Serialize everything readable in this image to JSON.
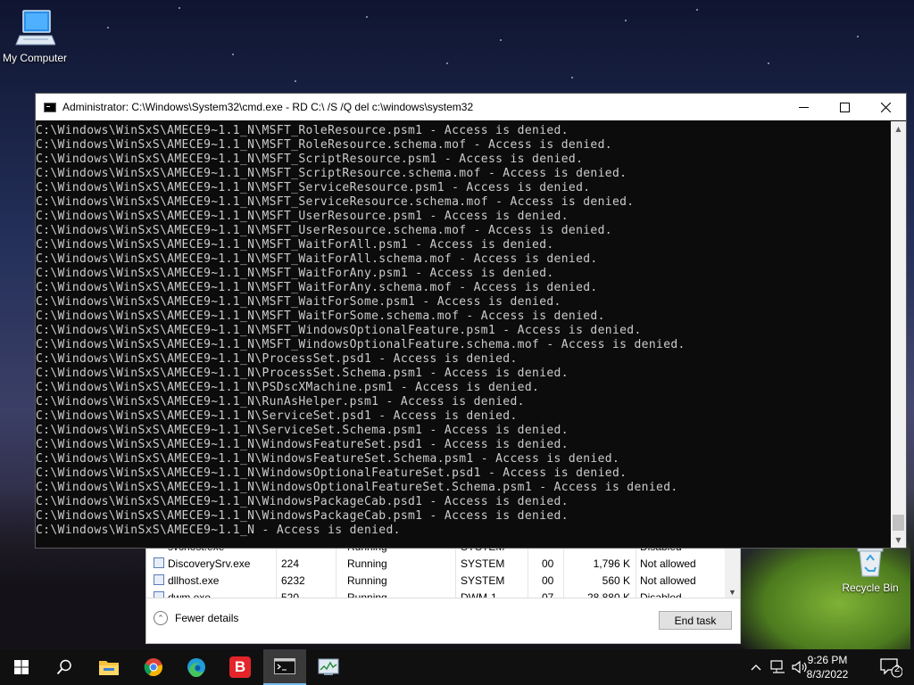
{
  "desktop": {
    "icons": [
      {
        "label": "My Computer",
        "icon": "computer-icon"
      },
      {
        "label": "Recycle Bin",
        "icon": "recycle-bin-icon"
      }
    ]
  },
  "task_manager": {
    "partial_row": {
      "name": "svchost.exe",
      "pid": "",
      "status": "Running",
      "user": "SYSTEM",
      "cpu": "",
      "memory": "",
      "uac": "Disabled"
    },
    "rows": [
      {
        "name": "DiscoverySrv.exe",
        "pid": "224",
        "status": "Running",
        "user": "SYSTEM",
        "cpu": "00",
        "memory": "1,796 K",
        "uac": "Not allowed"
      },
      {
        "name": "dllhost.exe",
        "pid": "6232",
        "status": "Running",
        "user": "SYSTEM",
        "cpu": "00",
        "memory": "560 K",
        "uac": "Not allowed"
      },
      {
        "name": "dwm.exe",
        "pid": "520",
        "status": "Running",
        "user": "DWM-1",
        "cpu": "07",
        "memory": "28,880 K",
        "uac": "Disabled"
      }
    ],
    "fewer_details_label": "Fewer details",
    "end_task_label": "End task"
  },
  "cmd": {
    "title": "Administrator: C:\\Windows\\System32\\cmd.exe - RD  C:\\ /S /Q del c:\\windows\\system32",
    "lines": [
      "C:\\Windows\\WinSxS\\AMECE9~1.1_N\\MSFT_RoleResource.psm1 - Access is denied.",
      "C:\\Windows\\WinSxS\\AMECE9~1.1_N\\MSFT_RoleResource.schema.mof - Access is denied.",
      "C:\\Windows\\WinSxS\\AMECE9~1.1_N\\MSFT_ScriptResource.psm1 - Access is denied.",
      "C:\\Windows\\WinSxS\\AMECE9~1.1_N\\MSFT_ScriptResource.schema.mof - Access is denied.",
      "C:\\Windows\\WinSxS\\AMECE9~1.1_N\\MSFT_ServiceResource.psm1 - Access is denied.",
      "C:\\Windows\\WinSxS\\AMECE9~1.1_N\\MSFT_ServiceResource.schema.mof - Access is denied.",
      "C:\\Windows\\WinSxS\\AMECE9~1.1_N\\MSFT_UserResource.psm1 - Access is denied.",
      "C:\\Windows\\WinSxS\\AMECE9~1.1_N\\MSFT_UserResource.schema.mof - Access is denied.",
      "C:\\Windows\\WinSxS\\AMECE9~1.1_N\\MSFT_WaitForAll.psm1 - Access is denied.",
      "C:\\Windows\\WinSxS\\AMECE9~1.1_N\\MSFT_WaitForAll.schema.mof - Access is denied.",
      "C:\\Windows\\WinSxS\\AMECE9~1.1_N\\MSFT_WaitForAny.psm1 - Access is denied.",
      "C:\\Windows\\WinSxS\\AMECE9~1.1_N\\MSFT_WaitForAny.schema.mof - Access is denied.",
      "C:\\Windows\\WinSxS\\AMECE9~1.1_N\\MSFT_WaitForSome.psm1 - Access is denied.",
      "C:\\Windows\\WinSxS\\AMECE9~1.1_N\\MSFT_WaitForSome.schema.mof - Access is denied.",
      "C:\\Windows\\WinSxS\\AMECE9~1.1_N\\MSFT_WindowsOptionalFeature.psm1 - Access is denied.",
      "C:\\Windows\\WinSxS\\AMECE9~1.1_N\\MSFT_WindowsOptionalFeature.schema.mof - Access is denied.",
      "C:\\Windows\\WinSxS\\AMECE9~1.1_N\\ProcessSet.psd1 - Access is denied.",
      "C:\\Windows\\WinSxS\\AMECE9~1.1_N\\ProcessSet.Schema.psm1 - Access is denied.",
      "C:\\Windows\\WinSxS\\AMECE9~1.1_N\\PSDscXMachine.psm1 - Access is denied.",
      "C:\\Windows\\WinSxS\\AMECE9~1.1_N\\RunAsHelper.psm1 - Access is denied.",
      "C:\\Windows\\WinSxS\\AMECE9~1.1_N\\ServiceSet.psd1 - Access is denied.",
      "C:\\Windows\\WinSxS\\AMECE9~1.1_N\\ServiceSet.Schema.psm1 - Access is denied.",
      "C:\\Windows\\WinSxS\\AMECE9~1.1_N\\WindowsFeatureSet.psd1 - Access is denied.",
      "C:\\Windows\\WinSxS\\AMECE9~1.1_N\\WindowsFeatureSet.Schema.psm1 - Access is denied.",
      "C:\\Windows\\WinSxS\\AMECE9~1.1_N\\WindowsOptionalFeatureSet.psd1 - Access is denied.",
      "C:\\Windows\\WinSxS\\AMECE9~1.1_N\\WindowsOptionalFeatureSet.Schema.psm1 - Access is denied.",
      "C:\\Windows\\WinSxS\\AMECE9~1.1_N\\WindowsPackageCab.psd1 - Access is denied.",
      "C:\\Windows\\WinSxS\\AMECE9~1.1_N\\WindowsPackageCab.psm1 - Access is denied.",
      "C:\\Windows\\WinSxS\\AMECE9~1.1_N - Access is denied."
    ],
    "text_color": "#cccccc",
    "background": "#0c0c0c"
  },
  "taskbar": {
    "items": [
      {
        "icon": "windows-start-icon"
      },
      {
        "icon": "search-icon"
      },
      {
        "icon": "file-explorer-icon"
      },
      {
        "icon": "chrome-icon"
      },
      {
        "icon": "edge-icon"
      },
      {
        "icon": "bitdefender-icon",
        "letter": "B"
      },
      {
        "icon": "command-prompt-icon",
        "active": true
      },
      {
        "icon": "task-manager-icon"
      }
    ],
    "clock": {
      "time": "9:26 PM",
      "date": "8/3/2022"
    },
    "notifications_count": "2"
  }
}
